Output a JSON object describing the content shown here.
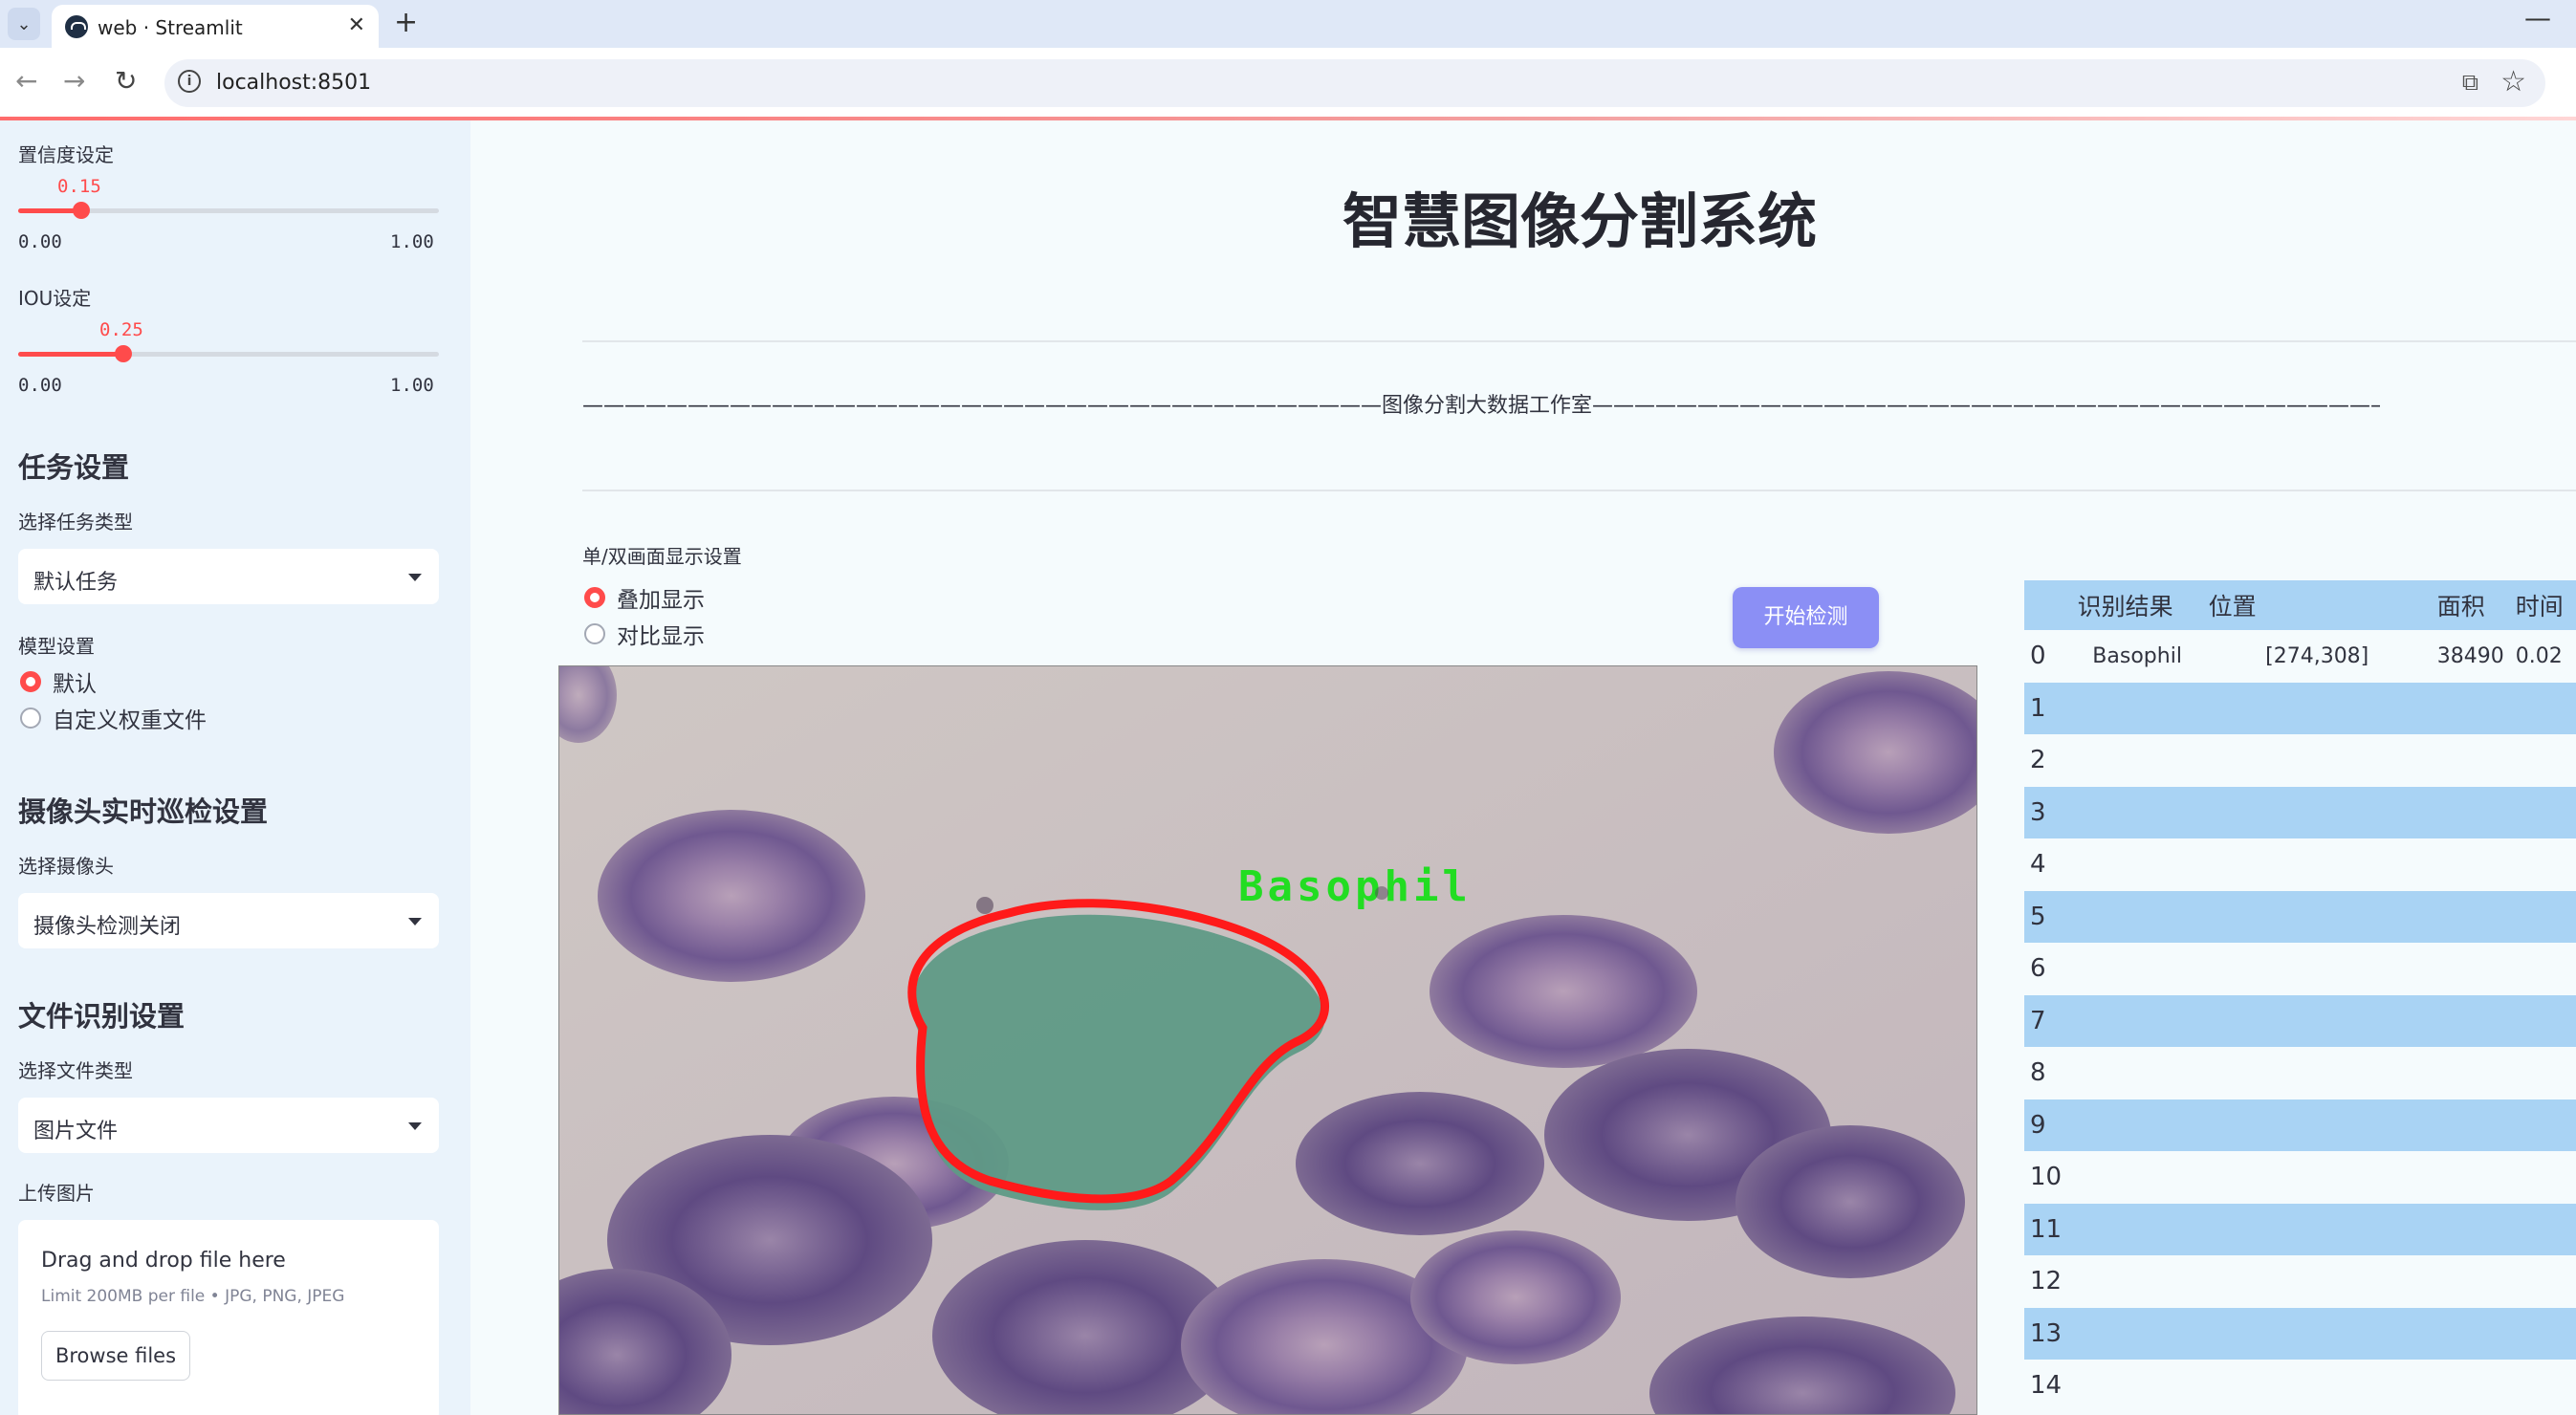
{
  "browser": {
    "tab_title": "web · Streamlit",
    "url": "localhost:8501"
  },
  "sidebar": {
    "confidence": {
      "label": "置信度设定",
      "value": 0.15,
      "value_text": "0.15",
      "min": "0.00",
      "max": "1.00"
    },
    "iou": {
      "label": "IOU设定",
      "value": 0.25,
      "value_text": "0.25",
      "min": "0.00",
      "max": "1.00"
    },
    "task_heading": "任务设置",
    "task_type_label": "选择任务类型",
    "task_type_value": "默认任务",
    "model_label": "模型设置",
    "model_options": [
      "默认",
      "自定义权重文件"
    ],
    "model_selected": "默认",
    "camera_heading": "摄像头实时巡检设置",
    "camera_label": "选择摄像头",
    "camera_value": "摄像头检测关闭",
    "file_heading": "文件识别设置",
    "file_type_label": "选择文件类型",
    "file_type_value": "图片文件",
    "upload_label": "上传图片",
    "upload_title": "Drag and drop file here",
    "upload_limit": "Limit 200MB per file • JPG, PNG, JPEG",
    "browse_label": "Browse files"
  },
  "main": {
    "title": "智慧图像分割系统",
    "studio_line": "——————————————————————————————————————图像分割大数据工作室——————————————————————————————————————————",
    "display_label": "单/双画面显示设置",
    "display_options": [
      "叠加显示",
      "对比显示"
    ],
    "display_selected": "叠加显示",
    "detect_button": "开始检测",
    "detection_label": "Basophil"
  },
  "table": {
    "headers": [
      "",
      "识别结果",
      "位置",
      "面积",
      "时间"
    ],
    "rows": [
      [
        "0",
        "Basophil",
        "[274,308]",
        "38490",
        "0.02"
      ],
      [
        "1",
        "",
        "",
        "",
        ""
      ],
      [
        "2",
        "",
        "",
        "",
        ""
      ],
      [
        "3",
        "",
        "",
        "",
        ""
      ],
      [
        "4",
        "",
        "",
        "",
        ""
      ],
      [
        "5",
        "",
        "",
        "",
        ""
      ],
      [
        "6",
        "",
        "",
        "",
        ""
      ],
      [
        "7",
        "",
        "",
        "",
        ""
      ],
      [
        "8",
        "",
        "",
        "",
        ""
      ],
      [
        "9",
        "",
        "",
        "",
        ""
      ],
      [
        "10",
        "",
        "",
        "",
        ""
      ],
      [
        "11",
        "",
        "",
        "",
        ""
      ],
      [
        "12",
        "",
        "",
        "",
        ""
      ],
      [
        "13",
        "",
        "",
        "",
        ""
      ],
      [
        "14",
        "",
        "",
        "",
        ""
      ]
    ]
  },
  "colors": {
    "accent": "#ff4b4b",
    "sidebar_bg": "#eaf3fb",
    "button": "#8b8ff5",
    "table_stripe": "#a9d3f4",
    "mask_outline": "#ff1a1a",
    "label_text": "#22dd22"
  }
}
